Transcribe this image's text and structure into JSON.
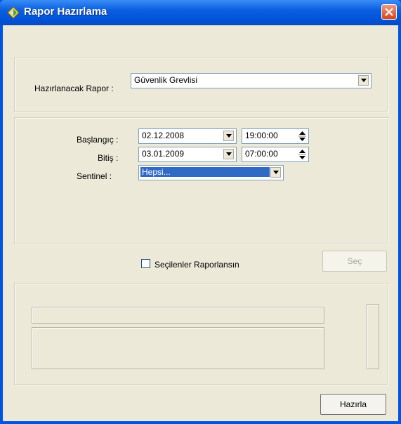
{
  "window": {
    "title": "Rapor Hazırlama",
    "icons": {
      "app": "diamond-arrows-icon",
      "close": "close-icon"
    }
  },
  "report_group": {
    "report_label": "Hazırlanacak Rapor :",
    "report_value": "Güvenlik Grevlisi"
  },
  "filter_group": {
    "start_label": "Başlangıç :",
    "start_date": "02.12.2008",
    "start_time": "19:00:00",
    "end_label": "Bitiş :",
    "end_date": "03.01.2009",
    "end_time": "07:00:00",
    "sentinel_label": "Sentinel :",
    "sentinel_value": "Hepsi..."
  },
  "options": {
    "checkbox_label": "Seçilenler Raporlansın",
    "checkbox_checked": false,
    "select_button": "Seç"
  },
  "footer": {
    "prepare_button": "Hazırla"
  },
  "colors": {
    "titlebar": "#0a5fe0",
    "client": "#ece9d8",
    "selection": "#316ac5",
    "close": "#d8431b"
  }
}
